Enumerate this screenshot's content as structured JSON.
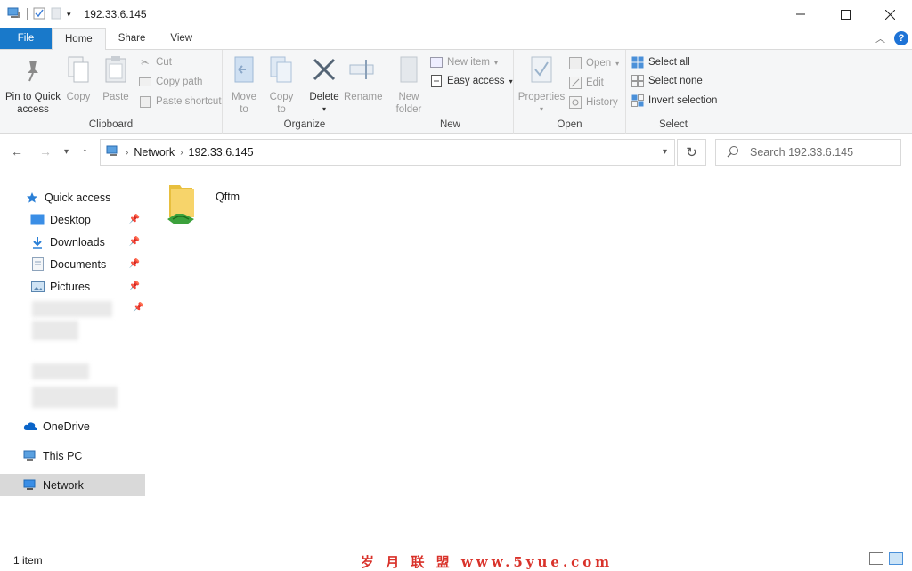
{
  "window": {
    "title": "192.33.6.145"
  },
  "tabs": [
    {
      "label": "File"
    },
    {
      "label": "Home"
    },
    {
      "label": "Share"
    },
    {
      "label": "View"
    }
  ],
  "ribbon": {
    "clipboard": {
      "label": "Clipboard",
      "pin": "Pin to Quick\naccess",
      "copy": "Copy",
      "paste": "Paste",
      "cut": "Cut",
      "copy_path": "Copy path",
      "paste_shortcut": "Paste shortcut"
    },
    "organize": {
      "label": "Organize",
      "move_to": "Move\nto",
      "copy_to": "Copy\nto",
      "delete": "Delete",
      "rename": "Rename"
    },
    "new": {
      "label": "New",
      "new_folder": "New\nfolder",
      "new_item": "New item",
      "easy_access": "Easy access"
    },
    "open": {
      "label": "Open",
      "properties": "Properties",
      "open": "Open",
      "edit": "Edit",
      "history": "History"
    },
    "select": {
      "label": "Select",
      "select_all": "Select all",
      "select_none": "Select none",
      "invert": "Invert selection"
    }
  },
  "address": {
    "crumbs": [
      "Network",
      "192.33.6.145"
    ],
    "search_placeholder": "Search 192.33.6.145"
  },
  "nav": {
    "quick_access": "Quick access",
    "items": [
      {
        "label": "Desktop",
        "icon": "desktop-icon"
      },
      {
        "label": "Downloads",
        "icon": "downloads-icon"
      },
      {
        "label": "Documents",
        "icon": "documents-icon"
      },
      {
        "label": "Pictures",
        "icon": "pictures-icon"
      }
    ],
    "onedrive": "OneDrive",
    "this_pc": "This PC",
    "network": "Network"
  },
  "content": {
    "files": [
      {
        "name": "Qftm",
        "icon": "shared-folder-icon"
      }
    ]
  },
  "status": {
    "count": "1 item"
  },
  "watermark": "岁 月 联 盟  www.5yue.com",
  "colors": {
    "accent": "#1979ca",
    "selected_nav": "#d9d9d9"
  }
}
